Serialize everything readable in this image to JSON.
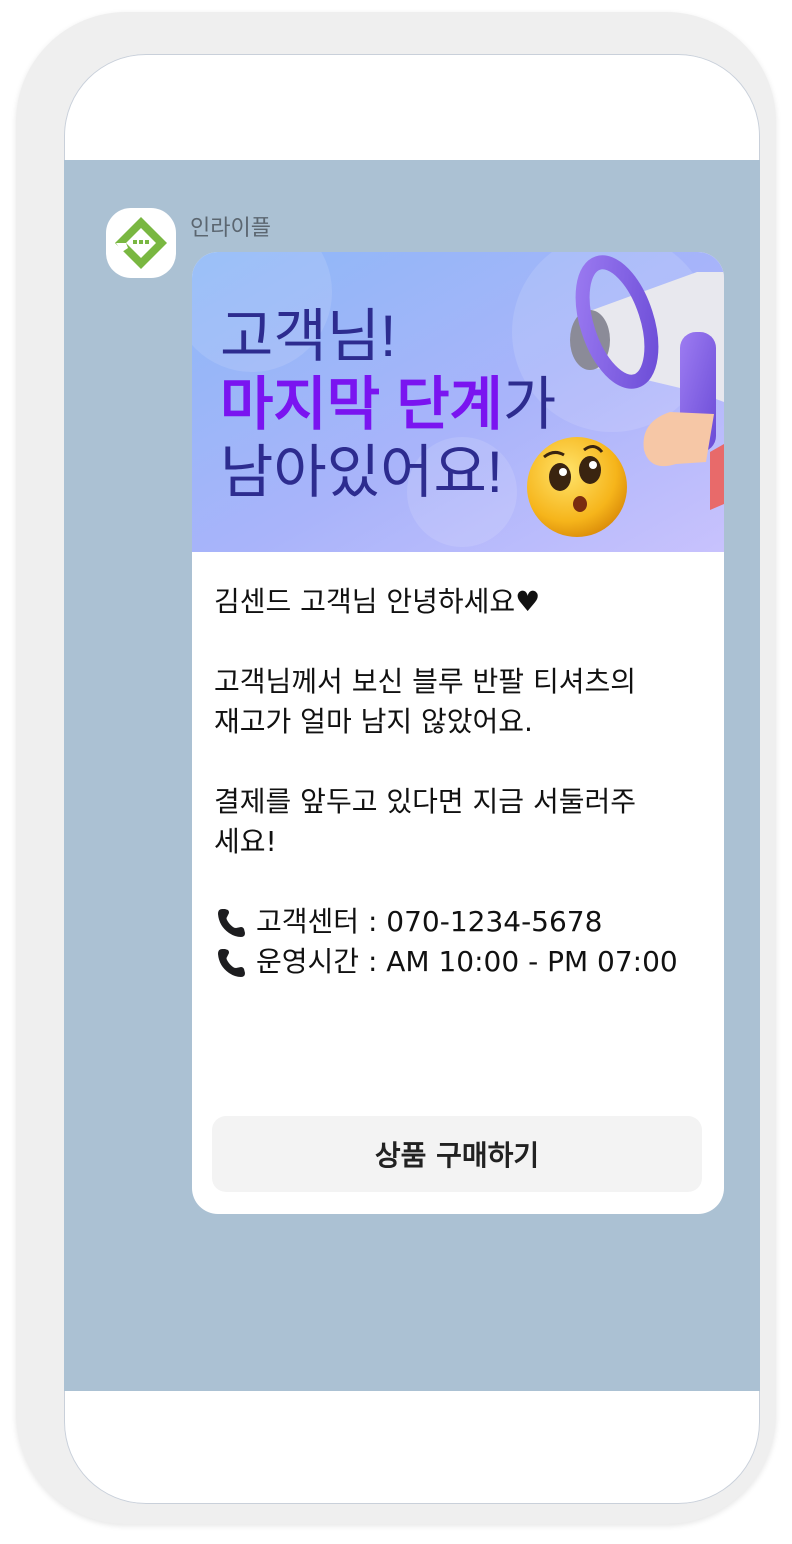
{
  "sender": {
    "name": "인라이플",
    "avatar_icon": "inraifle-logo-icon",
    "logo_color": "#79b741"
  },
  "banner": {
    "line1": "고객님!",
    "line2_highlight": "마지막 단계",
    "line2_rest": "가",
    "line3": "남아있어요!",
    "highlight_color": "#7a14f0",
    "text_color": "#2d2c8f",
    "icons": [
      "megaphone-icon",
      "worried-emoji-icon"
    ]
  },
  "message": {
    "greeting": "김센드 고객님 안녕하세요♥",
    "line1": "고객님께서 보신 블루 반팔 티셔츠의",
    "line2": "재고가 얼마 남지 않았어요.",
    "line3": "결제를 앞두고 있다면 지금 서둘러주",
    "line4": "세요!",
    "contact1": "고객센터 : 070-1234-5678",
    "contact2": "운영시간 : AM 10:00 - PM 07:00",
    "contact_icon": "telephone-icon"
  },
  "button": {
    "label": "상품 구매하기"
  },
  "colors": {
    "chat_background": "#abc1d3",
    "frame": "#efefef",
    "button_background": "#f3f3f3"
  }
}
